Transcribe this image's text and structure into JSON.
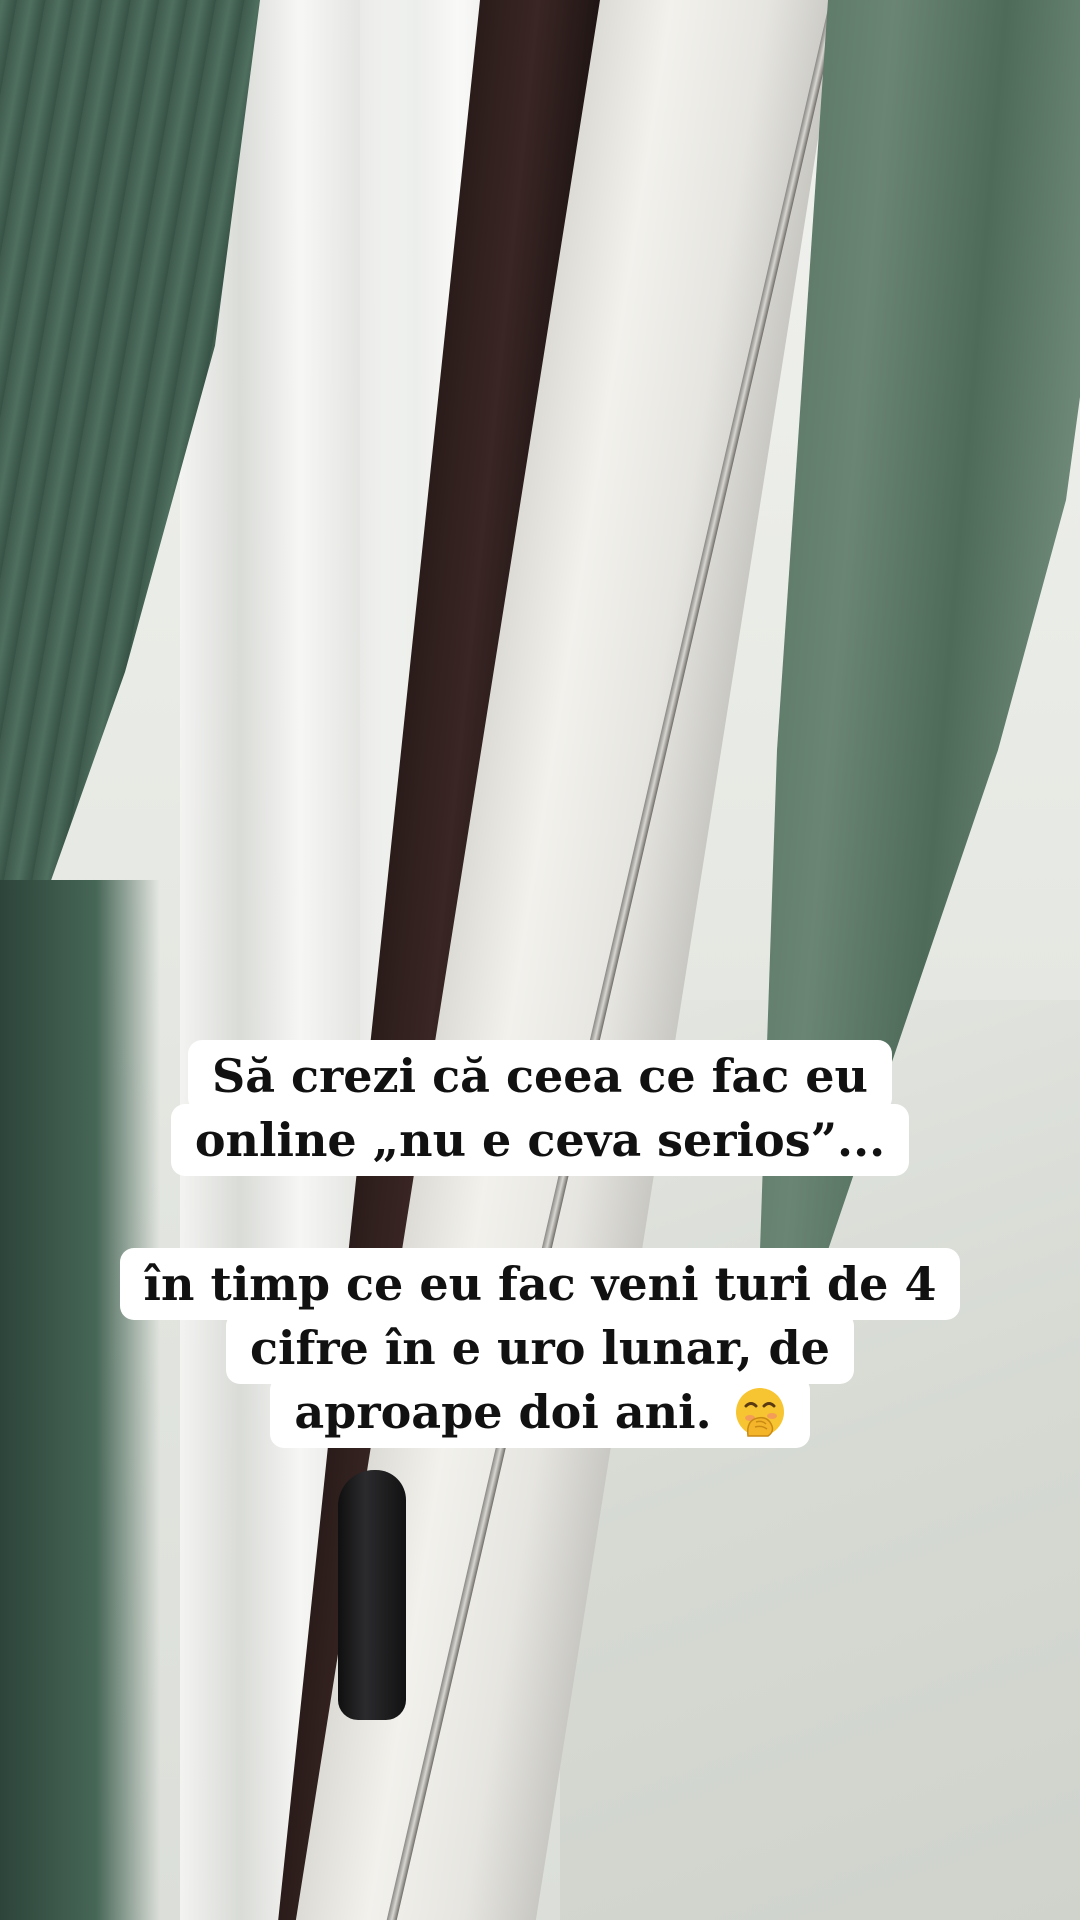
{
  "story": {
    "caption_1": {
      "lines": [
        "Să crezi că ceea ce fac eu",
        "online „nu e ceva serios”..."
      ]
    },
    "caption_2": {
      "lines": [
        "în timp ce eu fac veni turi de 4",
        "cifre în e uro lunar, de",
        "aproape doi ani."
      ],
      "emoji": "face-with-hand-over-mouth-icon"
    }
  },
  "colors": {
    "curtain_green": "#4f6f5f",
    "frame_dark": "#2a1c1a",
    "text_box": "#ffffff",
    "text": "#111111"
  }
}
